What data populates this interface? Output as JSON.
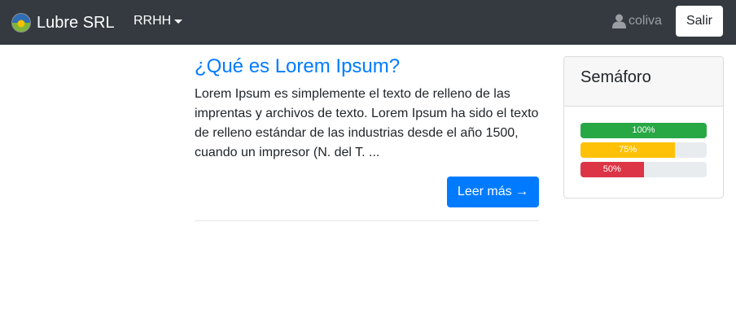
{
  "navbar": {
    "brand": "Lubre SRL",
    "menu_label": "RRHH",
    "username": "coliva",
    "logout_label": "Salir"
  },
  "post": {
    "title": "¿Qué es Lorem Ipsum?",
    "excerpt": "Lorem Ipsum es simplemente el texto de relleno de las imprentas y archivos de texto. Lorem Ipsum ha sido el texto de relleno estándar de las industrias desde el año 1500, cuando un impresor (N. del T. ...",
    "read_more": "Leer más →"
  },
  "semaforo": {
    "title": "Semáforo",
    "bars": [
      {
        "label": "100%",
        "value": 100,
        "color": "#28a745"
      },
      {
        "label": "75%",
        "value": 75,
        "color": "#ffc107"
      },
      {
        "label": "50%",
        "value": 50,
        "color": "#dc3545"
      }
    ]
  }
}
